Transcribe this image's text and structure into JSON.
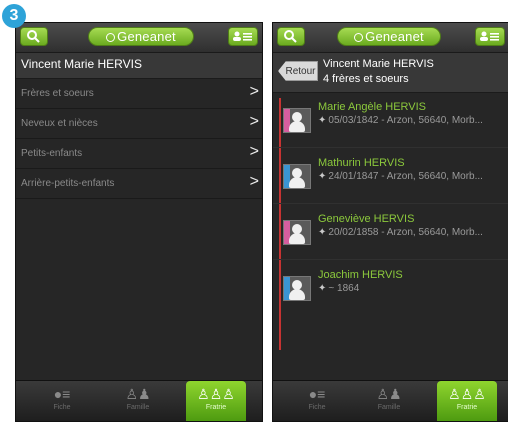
{
  "step_badge": "3",
  "app": {
    "logo": "Geneanet"
  },
  "left": {
    "person_name": "Vincent Marie HERVIS",
    "menu": [
      {
        "label": "Frères et soeurs"
      },
      {
        "label": "Neveux et nièces"
      },
      {
        "label": "Petits-enfants"
      },
      {
        "label": "Arrière-petits-enfants"
      }
    ],
    "chevron": ">"
  },
  "right": {
    "back_label": "Retour",
    "title": "Vincent Marie HERVIS",
    "count": "4 frères et soeurs",
    "siblings": [
      {
        "name": "Marie Angèle HERVIS",
        "info": "05/03/1842 - Arzon, 56640, Morb...",
        "gender": "female"
      },
      {
        "name": "Mathurin HERVIS",
        "info": "24/01/1847 - Arzon, 56640, Morb...",
        "gender": "male"
      },
      {
        "name": "Geneviève HERVIS",
        "info": "20/02/1858 - Arzon, 56640, Morb...",
        "gender": "female"
      },
      {
        "name": "Joachim HERVIS",
        "info": "~ 1864",
        "gender": "male"
      }
    ]
  },
  "tabs": [
    {
      "icon": "person-list-icon",
      "label": "Fiche",
      "active": false
    },
    {
      "icon": "family-icon",
      "label": "Famille",
      "active": false
    },
    {
      "icon": "fratrie-icon",
      "label": "Fratrie",
      "active": true
    }
  ],
  "colors": {
    "accent_green": "#8cc93c",
    "timeline_red": "#c73332",
    "badge_blue": "#2ea3d8"
  }
}
